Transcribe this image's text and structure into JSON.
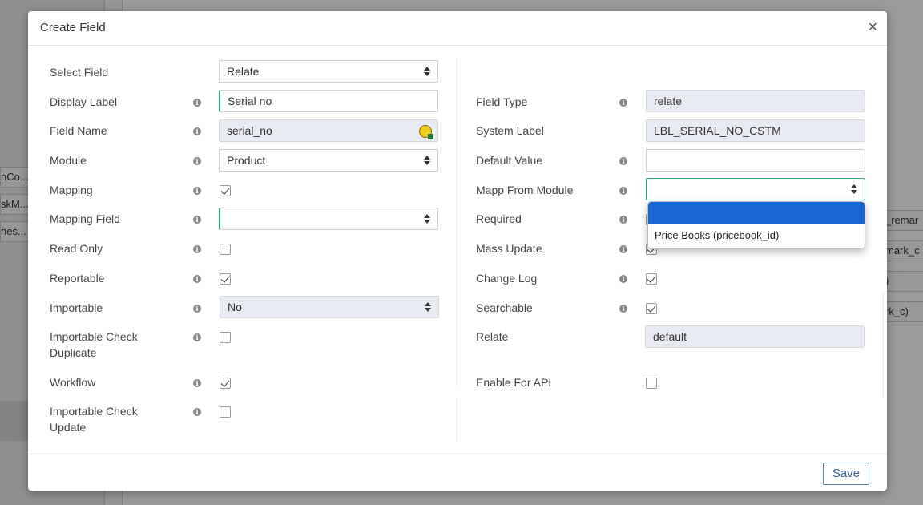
{
  "background": {
    "rows_left": [
      "nCo...",
      "skM...",
      "nes..."
    ],
    "rows_right": [
      "_remar",
      "mark_c",
      ")",
      "rk_c)"
    ]
  },
  "modal": {
    "title": "Create Field",
    "close_symbol": "×",
    "save_label": "Save"
  },
  "left_fields": {
    "select_field": {
      "label": "Select Field",
      "value": "Relate"
    },
    "display_label": {
      "label": "Display Label",
      "value": "Serial no"
    },
    "field_name": {
      "label": "Field Name",
      "value": "serial_no"
    },
    "module": {
      "label": "Module",
      "value": "Product"
    },
    "mapping": {
      "label": "Mapping",
      "checked": true
    },
    "mapping_field": {
      "label": "Mapping Field",
      "value": ""
    },
    "read_only": {
      "label": "Read Only",
      "checked": false
    },
    "reportable": {
      "label": "Reportable",
      "checked": true
    },
    "importable": {
      "label": "Importable",
      "value": "No"
    },
    "importable_check_duplicate": {
      "label_line1": "Importable Check",
      "label_line2": "Duplicate",
      "checked": false
    },
    "workflow": {
      "label": "Workflow",
      "checked": true
    },
    "importable_check_update": {
      "label_line1": "Importable Check",
      "label_line2": "Update",
      "checked": false
    }
  },
  "right_fields": {
    "field_type": {
      "label": "Field Type",
      "value": "relate"
    },
    "system_label": {
      "label": "System Label",
      "value": "LBL_SERIAL_NO_CSTM"
    },
    "default_value": {
      "label": "Default Value",
      "value": ""
    },
    "mapp_from_module": {
      "label": "Mapp From Module",
      "value": ""
    },
    "required": {
      "label": "Required",
      "checked": false
    },
    "mass_update": {
      "label": "Mass Update",
      "checked": true
    },
    "change_log": {
      "label": "Change Log",
      "checked": true
    },
    "searchable": {
      "label": "Searchable",
      "checked": true
    },
    "relate": {
      "label": "Relate",
      "value": "default"
    },
    "enable_for_api": {
      "label": "Enable For API",
      "checked": false
    }
  },
  "dropdown": {
    "options": [
      "",
      "Price Books (pricebook_id)"
    ],
    "selected_index": 0
  },
  "colors": {
    "accent": "#3aa38e",
    "selected_option": "#1a66d6",
    "save_border": "#5a7fb8"
  },
  "icons": {
    "info": "info-icon",
    "select_caret": "sort-caret-icon",
    "lock": "lock-icon",
    "close": "close-icon",
    "checkbox_mark": "check-icon"
  }
}
